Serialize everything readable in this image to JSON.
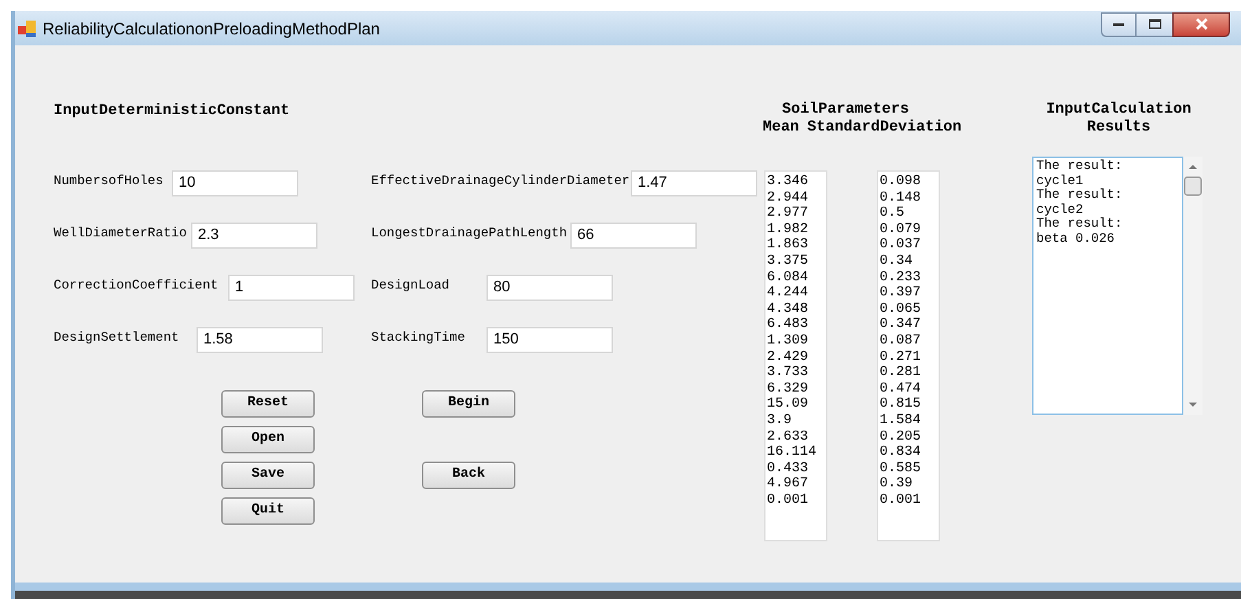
{
  "window": {
    "title": "ReliabilityCalculationonPreloadingMethodPlan"
  },
  "deterministic": {
    "heading": "InputDeterministicConstant",
    "left_fields": [
      {
        "label": "NumbersofHoles",
        "value": "10"
      },
      {
        "label": "WellDiameterRatio",
        "value": "2.3"
      },
      {
        "label": "CorrectionCoefficient",
        "value": "1"
      },
      {
        "label": "DesignSettlement",
        "value": "1.58"
      }
    ],
    "right_fields": [
      {
        "label": "EffectiveDrainageCylinderDiameter",
        "value": "1.47"
      },
      {
        "label": "LongestDrainagePathLength",
        "value": "66"
      },
      {
        "label": "DesignLoad",
        "value": "80"
      },
      {
        "label": "StackingTime",
        "value": "150"
      }
    ]
  },
  "buttons_left": [
    "Reset",
    "Open",
    "Save",
    "Quit"
  ],
  "buttons_right": [
    "Begin",
    "Back"
  ],
  "soil": {
    "heading": "SoilParameters",
    "mean_header": "Mean",
    "sd_header": "StandardDeviation",
    "mean": [
      "3.346",
      "2.944",
      "2.977",
      "1.982",
      "1.863",
      "3.375",
      "6.084",
      "4.244",
      "4.348",
      "6.483",
      "1.309",
      "2.429",
      "3.733",
      "6.329",
      "15.09",
      "3.9",
      "2.633",
      "16.114",
      "0.433",
      "4.967",
      "0.001"
    ],
    "sd": [
      "0.098",
      "0.148",
      "0.5",
      "0.079",
      "0.037",
      "0.34",
      "0.233",
      "0.397",
      "0.065",
      "0.347",
      "0.087",
      "0.271",
      "0.281",
      "0.474",
      "0.815",
      "1.584",
      "0.205",
      "0.834",
      "0.585",
      "0.39",
      "0.001"
    ]
  },
  "results": {
    "heading": "InputCalculation Results",
    "lines": [
      "The result:",
      "cycle1",
      "The result:",
      "cycle2",
      "The result:",
      "beta 0.026"
    ]
  }
}
